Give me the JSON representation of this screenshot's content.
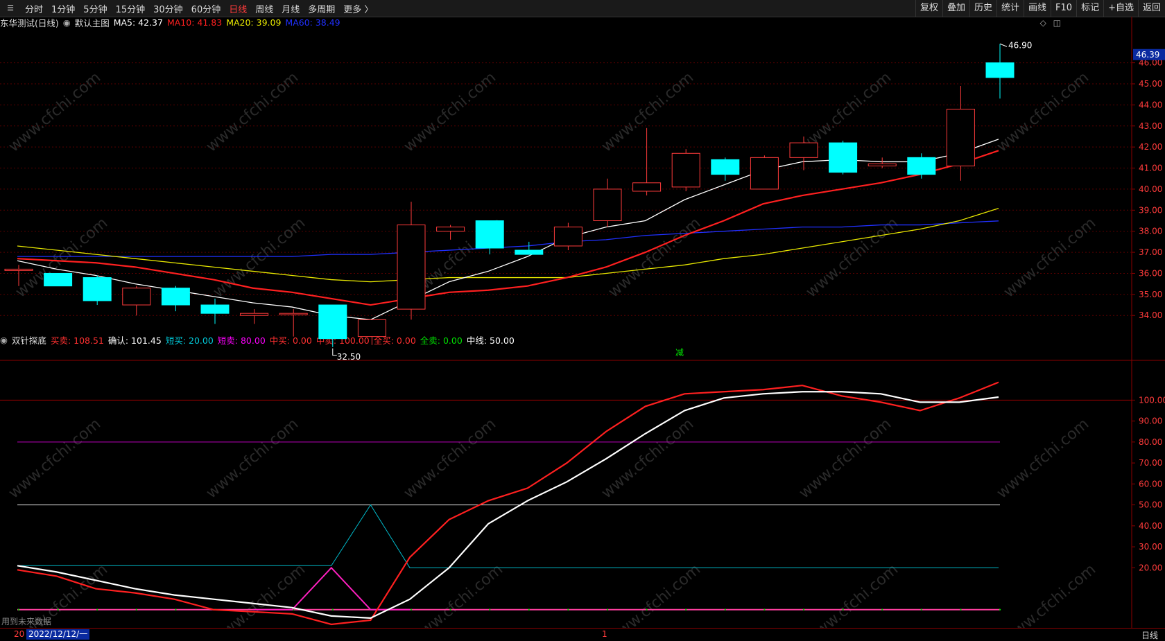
{
  "toolbar": {
    "periods": [
      "分时",
      "1分钟",
      "5分钟",
      "15分钟",
      "30分钟",
      "60分钟",
      "日线",
      "周线",
      "月线",
      "多周期",
      "更多 〉"
    ],
    "active_period": "日线",
    "right_buttons": [
      "复权",
      "叠加",
      "历史",
      "统计",
      "画线",
      "F10",
      "标记",
      "+自选",
      "返回"
    ]
  },
  "main_legend": {
    "stock_name": "东华测试(日线)",
    "template": "默认主图",
    "ma5": "MA5: 42.37",
    "ma10": "MA10: 41.83",
    "ma20": "MA20: 39.09",
    "ma60": "MA60: 38.49"
  },
  "indicator_legend": {
    "name": "双针探底",
    "items": [
      {
        "text": "买卖: 108.51",
        "color": "#ff3030"
      },
      {
        "text": "确认: 101.45",
        "color": "#ffffff"
      },
      {
        "text": "短买: 20.00",
        "color": "#00c8d8"
      },
      {
        "text": "短卖: 80.00",
        "color": "#ff00ff"
      },
      {
        "text": "中买: 0.00",
        "color": "#ff3030"
      },
      {
        "text": "中卖: 100.00",
        "color": "#ff3030"
      },
      {
        "text": "全买: 0.00",
        "color": "#ff3030"
      },
      {
        "text": "全卖: 0.00",
        "color": "#00e000"
      },
      {
        "text": "中线: 50.00",
        "color": "#ffffff"
      }
    ]
  },
  "price_axis": {
    "current_price": "46.39",
    "labels": [
      "46.00",
      "45.00",
      "44.00",
      "43.00",
      "42.00",
      "41.00",
      "40.00",
      "39.00",
      "38.00",
      "37.00",
      "36.00",
      "35.00",
      "34.00"
    ]
  },
  "indicator_axis": {
    "labels": [
      "100.00",
      "90.00",
      "80.00",
      "70.00",
      "60.00",
      "50.00",
      "40.00",
      "30.00",
      "20.00"
    ]
  },
  "annotations": {
    "high_label": "46.90",
    "low_label": "32.50",
    "reduce_marker": "减"
  },
  "watermark": "www.cfchi.com",
  "bottom": {
    "future_note": "用到未来数据",
    "date": "2022/12/12/一",
    "date_prefix": "20",
    "cursor_mark": "1",
    "period": "日线"
  },
  "colors": {
    "up": "#ff3b3b",
    "down": "#00ffff",
    "ma5": "#ffffff",
    "ma10": "#ff2020",
    "ma20": "#e8e800",
    "ma60": "#2030ff"
  },
  "chart_data": {
    "type": "candlestick",
    "candles": [
      {
        "o": 36.2,
        "c": 36.2,
        "h": 36.4,
        "l": 35.4
      },
      {
        "o": 36.0,
        "c": 35.4,
        "h": 36.0,
        "l": 35.4
      },
      {
        "o": 35.8,
        "c": 34.7,
        "h": 35.9,
        "l": 34.5
      },
      {
        "o": 34.5,
        "c": 35.3,
        "h": 35.4,
        "l": 34.0
      },
      {
        "o": 35.3,
        "c": 34.5,
        "h": 35.4,
        "l": 34.2
      },
      {
        "o": 34.5,
        "c": 34.1,
        "h": 34.8,
        "l": 33.6
      },
      {
        "o": 34.0,
        "c": 34.1,
        "h": 34.3,
        "l": 33.6
      },
      {
        "o": 34.1,
        "c": 34.1,
        "h": 34.3,
        "l": 33.0
      },
      {
        "o": 34.5,
        "c": 32.9,
        "h": 34.5,
        "l": 32.5
      },
      {
        "o": 33.0,
        "c": 33.8,
        "h": 33.8,
        "l": 32.6
      },
      {
        "o": 34.3,
        "c": 38.3,
        "h": 39.4,
        "l": 33.8
      },
      {
        "o": 38.0,
        "c": 38.2,
        "h": 38.3,
        "l": 37.6
      },
      {
        "o": 38.5,
        "c": 37.2,
        "h": 38.5,
        "l": 36.9
      },
      {
        "o": 37.1,
        "c": 36.9,
        "h": 37.5,
        "l": 36.9
      },
      {
        "o": 37.3,
        "c": 38.2,
        "h": 38.4,
        "l": 37.1
      },
      {
        "o": 38.5,
        "c": 40.0,
        "h": 40.5,
        "l": 38.2
      },
      {
        "o": 39.9,
        "c": 40.3,
        "h": 42.9,
        "l": 39.7
      },
      {
        "o": 40.1,
        "c": 41.7,
        "h": 41.9,
        "l": 39.9
      },
      {
        "o": 41.4,
        "c": 40.7,
        "h": 41.5,
        "l": 40.4
      },
      {
        "o": 40.0,
        "c": 41.5,
        "h": 41.6,
        "l": 40.0
      },
      {
        "o": 41.5,
        "c": 42.2,
        "h": 42.5,
        "l": 40.9
      },
      {
        "o": 42.2,
        "c": 40.8,
        "h": 42.3,
        "l": 40.7
      },
      {
        "o": 41.1,
        "c": 41.2,
        "h": 41.5,
        "l": 41.0
      },
      {
        "o": 41.5,
        "c": 40.7,
        "h": 41.7,
        "l": 40.5
      },
      {
        "o": 41.1,
        "c": 43.8,
        "h": 44.9,
        "l": 40.4
      },
      {
        "o": 46.0,
        "c": 45.3,
        "h": 46.9,
        "l": 44.3
      }
    ],
    "ma5": [
      36.6,
      36.2,
      35.9,
      35.5,
      35.2,
      34.9,
      34.6,
      34.4,
      34.0,
      33.8,
      34.7,
      35.6,
      36.1,
      36.8,
      37.7,
      38.2,
      38.5,
      39.5,
      40.2,
      40.9,
      41.3,
      41.4,
      41.3,
      41.3,
      41.7,
      42.37
    ],
    "ma10": [
      36.7,
      36.6,
      36.5,
      36.3,
      36.0,
      35.7,
      35.3,
      35.1,
      34.8,
      34.5,
      34.8,
      35.1,
      35.2,
      35.4,
      35.8,
      36.3,
      37.0,
      37.8,
      38.5,
      39.3,
      39.7,
      40.0,
      40.3,
      40.7,
      41.2,
      41.83
    ],
    "ma20": [
      37.3,
      37.1,
      36.9,
      36.7,
      36.5,
      36.3,
      36.1,
      35.9,
      35.7,
      35.6,
      35.7,
      35.8,
      35.8,
      35.8,
      35.8,
      36.0,
      36.2,
      36.4,
      36.7,
      36.9,
      37.2,
      37.5,
      37.8,
      38.1,
      38.5,
      39.09
    ],
    "ma60": [
      36.8,
      36.8,
      36.8,
      36.8,
      36.8,
      36.8,
      36.8,
      36.8,
      36.9,
      36.9,
      37.0,
      37.1,
      37.2,
      37.3,
      37.5,
      37.6,
      37.8,
      37.9,
      38.0,
      38.1,
      38.2,
      38.2,
      38.3,
      38.3,
      38.4,
      38.49
    ],
    "price_ylim": [
      32.0,
      47.6
    ],
    "indicator": {
      "buy_sell": [
        19,
        16,
        10,
        8,
        5,
        0,
        -1,
        -2,
        -7,
        -5,
        25,
        43,
        52,
        58,
        70,
        85,
        97,
        103,
        104,
        105,
        107,
        102,
        99,
        95,
        101,
        108.51
      ],
      "confirm": [
        21,
        18,
        14,
        10,
        7,
        5,
        3,
        1,
        -3,
        -4,
        5,
        20,
        41,
        52,
        61,
        72,
        84,
        95,
        101,
        103,
        104,
        104,
        103,
        99,
        99,
        101.45
      ],
      "short_buy": [
        21,
        null,
        null,
        null,
        null,
        null,
        null,
        null,
        21,
        50,
        20,
        20,
        20,
        20,
        20,
        20,
        20,
        20,
        20,
        20,
        20,
        20,
        20,
        20,
        20,
        20
      ],
      "short_sell": [
        null,
        null,
        null,
        null,
        null,
        null,
        0,
        0,
        20,
        0,
        0,
        null,
        null,
        null,
        null,
        null,
        null,
        null,
        null,
        null,
        null,
        null,
        null,
        null,
        null,
        null
      ],
      "mid_line": 50,
      "levels": {
        "upper": 100,
        "sell": 80,
        "buy": 20,
        "zero": 0
      },
      "ylim": [
        -8,
        115
      ]
    }
  }
}
